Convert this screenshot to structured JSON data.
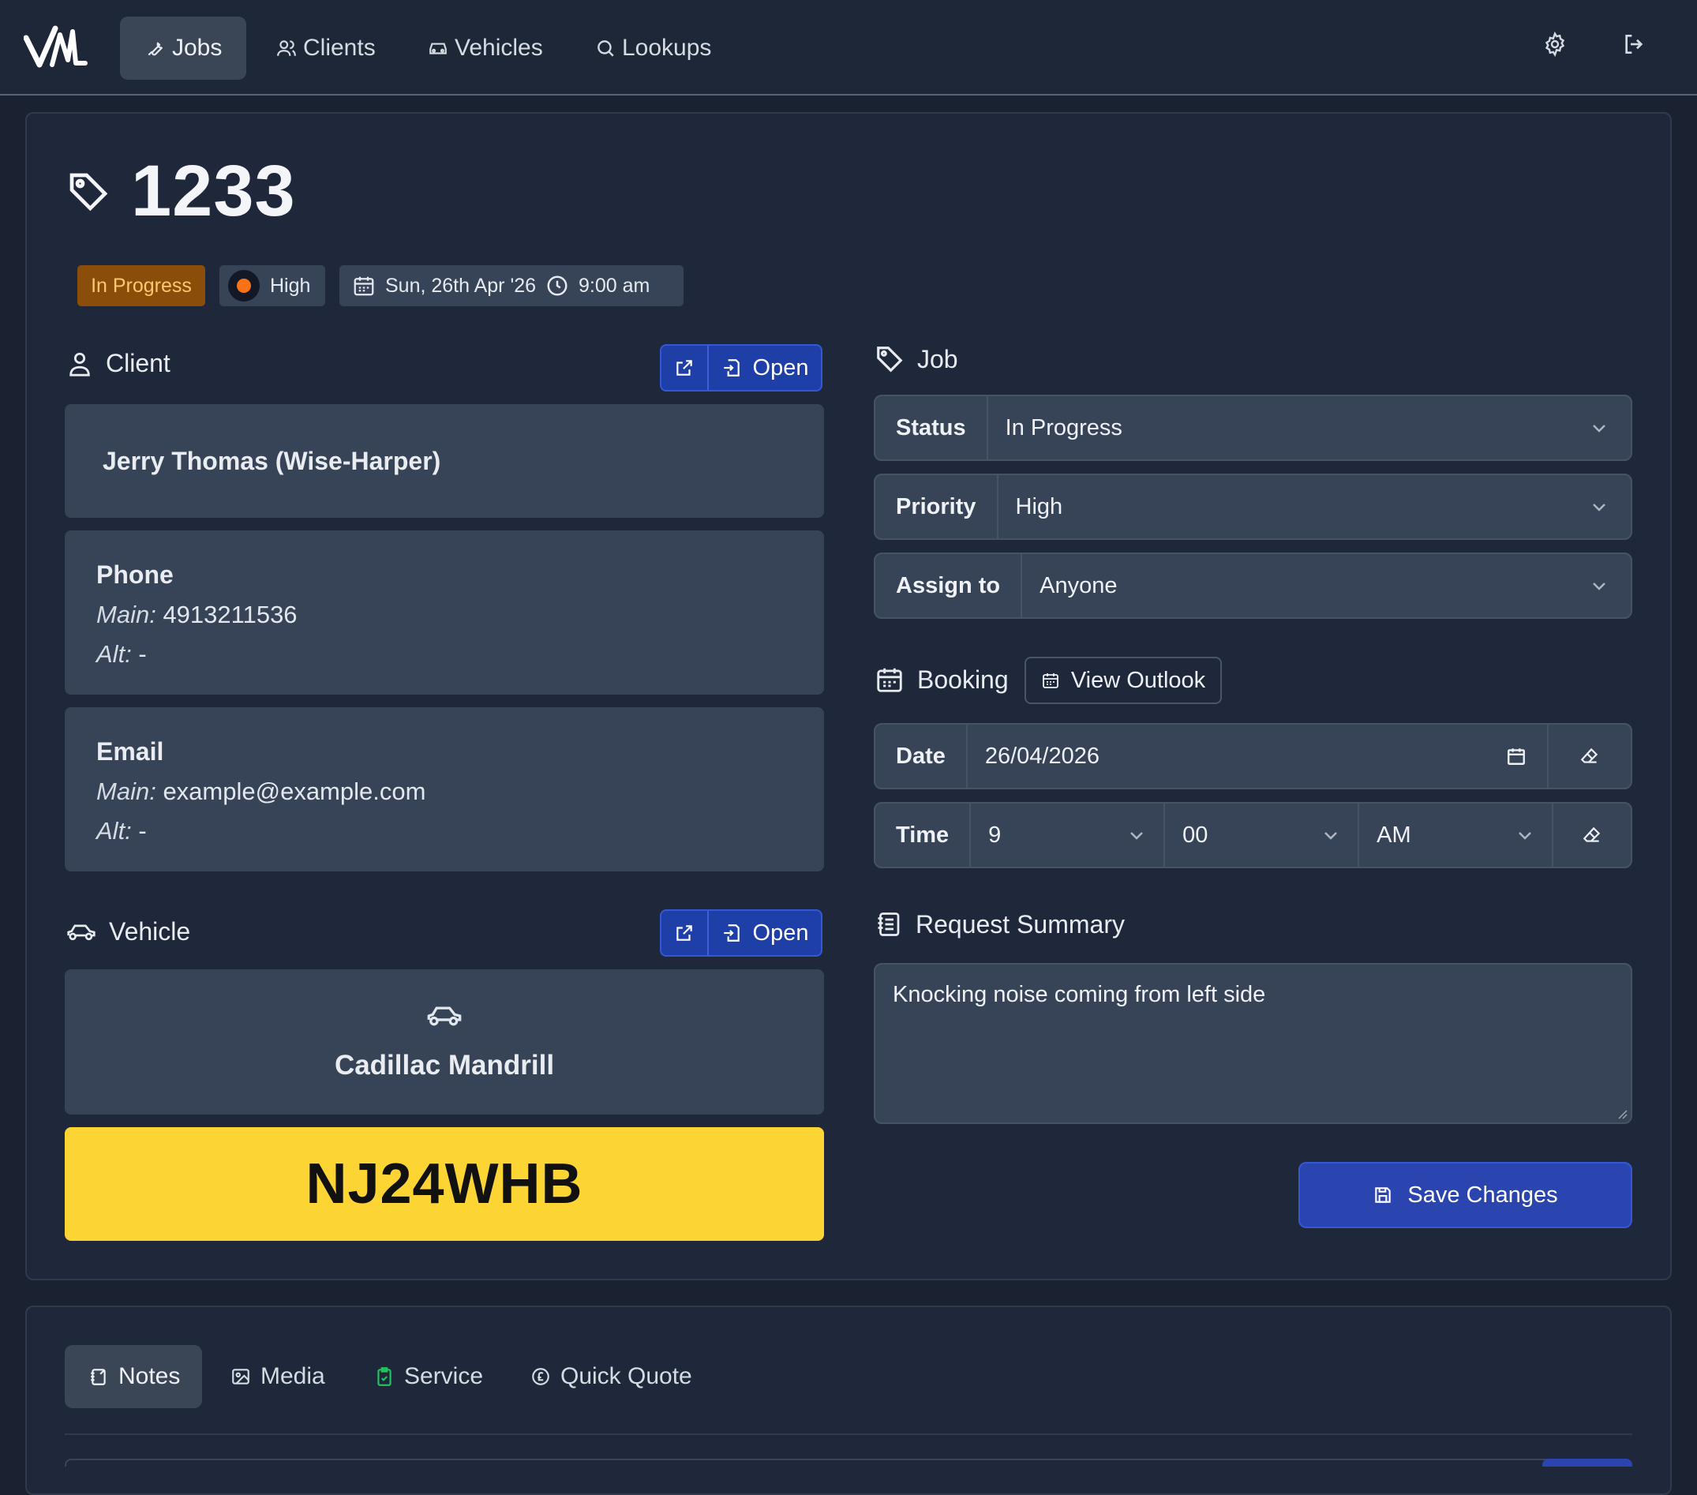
{
  "nav": {
    "logo": "VL",
    "items": [
      {
        "label": "Jobs",
        "icon": "wrench-icon",
        "active": true
      },
      {
        "label": "Clients",
        "icon": "users-icon",
        "active": false
      },
      {
        "label": "Vehicles",
        "icon": "car-icon",
        "active": false
      },
      {
        "label": "Lookups",
        "icon": "search-icon",
        "active": false
      }
    ],
    "settings_icon": "gear-icon",
    "logout_icon": "logout-icon"
  },
  "job": {
    "number": "1233",
    "status_badge": "In Progress",
    "priority_badge": "High",
    "date_badge": "Sun, 26th Apr '26",
    "time_badge": "9:00 am"
  },
  "client": {
    "heading": "Client",
    "open_label": "Open",
    "name": "Jerry Thomas (Wise-Harper)",
    "phone": {
      "title": "Phone",
      "main_label": "Main:",
      "main": "4913211536",
      "alt_label": "Alt:",
      "alt": "-"
    },
    "email": {
      "title": "Email",
      "main_label": "Main:",
      "main": "example@example.com",
      "alt_label": "Alt:",
      "alt": "-"
    }
  },
  "vehicle": {
    "heading": "Vehicle",
    "open_label": "Open",
    "name": "Cadillac Mandrill",
    "plate": "NJ24WHB"
  },
  "job_panel": {
    "heading": "Job",
    "status_label": "Status",
    "status_value": "In Progress",
    "priority_label": "Priority",
    "priority_value": "High",
    "assign_label": "Assign to",
    "assign_value": "Anyone"
  },
  "booking": {
    "heading": "Booking",
    "view_outlook": "View Outlook",
    "date_label": "Date",
    "date_value": "26/04/2026",
    "time_label": "Time",
    "hour": "9",
    "minute": "00",
    "ampm": "AM"
  },
  "request": {
    "heading": "Request Summary",
    "text": "Knocking noise coming from left side"
  },
  "save_label": "Save Changes",
  "tabs": [
    {
      "label": "Notes",
      "icon": "notes-icon",
      "active": true
    },
    {
      "label": "Media",
      "icon": "media-icon",
      "active": false
    },
    {
      "label": "Service",
      "icon": "clipboard-check-icon",
      "active": false
    },
    {
      "label": "Quick Quote",
      "icon": "pound-icon",
      "active": false
    }
  ],
  "colors": {
    "background": "#1a2130",
    "card": "#1f283a",
    "panel": "#374356",
    "accent_blue": "#2a44b0",
    "status_badge": "#8a4e0a",
    "plate_yellow": "#fcd534",
    "priority_dot": "#f97316"
  }
}
